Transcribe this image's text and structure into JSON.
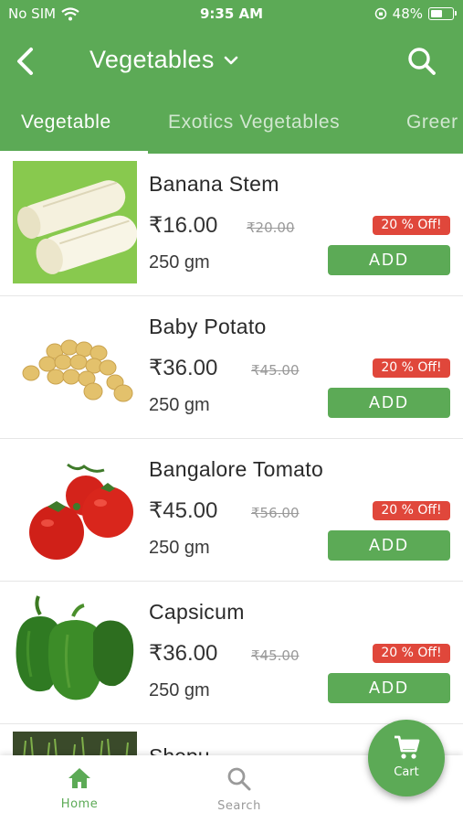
{
  "status_bar": {
    "carrier": "No SIM",
    "time": "9:35 AM",
    "battery": "48%",
    "battery_level": 0.48
  },
  "header": {
    "title": "Vegetables",
    "back_icon": "chevron-left-icon",
    "search_icon": "search-icon",
    "dropdown_icon": "chevron-down-icon"
  },
  "tabs": [
    {
      "label": "Vegetable",
      "active": true
    },
    {
      "label": "Exotics Vegetables",
      "active": false
    },
    {
      "label": "Greer",
      "active": false
    }
  ],
  "products": [
    {
      "name": "Banana Stem",
      "price": "₹16.00",
      "mrp": "₹20.00",
      "discount": "20 % Off!",
      "qty": "250 gm",
      "add_label": "ADD"
    },
    {
      "name": "Baby Potato",
      "price": "₹36.00",
      "mrp": "₹45.00",
      "discount": "20 % Off!",
      "qty": "250 gm",
      "add_label": "ADD"
    },
    {
      "name": "Bangalore Tomato",
      "price": "₹45.00",
      "mrp": "₹56.00",
      "discount": "20 % Off!",
      "qty": "250 gm",
      "add_label": "ADD"
    },
    {
      "name": "Capsicum",
      "price": "₹36.00",
      "mrp": "₹45.00",
      "discount": "20 % Off!",
      "qty": "250 gm",
      "add_label": "ADD"
    }
  ],
  "partial_product": {
    "name": "Shepu"
  },
  "bottom_nav": {
    "home": {
      "label": "Home",
      "icon": "home-icon"
    },
    "search": {
      "label": "Search",
      "icon": "search-icon"
    },
    "cart": {
      "label": "Cart",
      "icon": "cart-icon"
    }
  },
  "colors": {
    "brand_green": "#5caa56",
    "discount_red": "#e0473b",
    "white": "#ffffff"
  }
}
